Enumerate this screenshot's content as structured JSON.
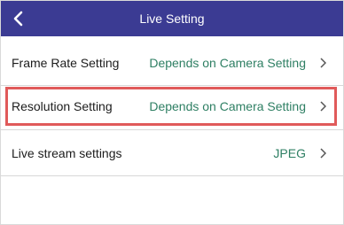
{
  "header": {
    "title": "Live Setting",
    "back_icon": "chevron-left-icon"
  },
  "rows": [
    {
      "label": "Frame Rate Setting",
      "value": "Depends on Camera Setting",
      "icon": "chevron-right-icon"
    },
    {
      "label": "Resolution Setting",
      "value": "Depends on Camera Setting",
      "icon": "chevron-right-icon"
    },
    {
      "label": "Live stream settings",
      "value": "JPEG",
      "icon": "chevron-right-icon"
    }
  ],
  "colors": {
    "header_bg": "#3b3b93",
    "value_text": "#2e7f63",
    "highlight": "#e05a5a"
  }
}
